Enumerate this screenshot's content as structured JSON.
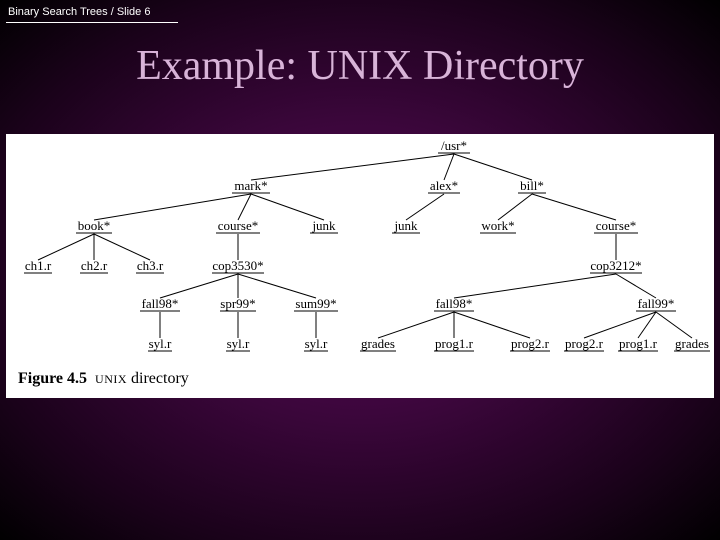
{
  "breadcrumb": "Binary Search Trees / Slide 6",
  "title": "Example: UNIX Directory",
  "caption": {
    "fignum": "Figure 4.5",
    "unix": "UNIX",
    "rest": "directory"
  },
  "tree": {
    "root": {
      "label": "/usr*"
    },
    "mark": {
      "label": "mark*"
    },
    "alex": {
      "label": "alex*"
    },
    "bill": {
      "label": "bill*"
    },
    "book": {
      "label": "book*"
    },
    "courseM": {
      "label": "course*"
    },
    "junkM": {
      "label": "junk"
    },
    "junkA": {
      "label": "junk"
    },
    "work": {
      "label": "work*"
    },
    "courseB": {
      "label": "course*"
    },
    "ch1": {
      "label": "ch1.r"
    },
    "ch2": {
      "label": "ch2.r"
    },
    "ch3": {
      "label": "ch3.r"
    },
    "cop3530": {
      "label": "cop3530*"
    },
    "cop3212": {
      "label": "cop3212*"
    },
    "fall98M": {
      "label": "fall98*"
    },
    "spr99": {
      "label": "spr99*"
    },
    "sum99": {
      "label": "sum99*"
    },
    "fall98B": {
      "label": "fall98*"
    },
    "fall99B": {
      "label": "fall99*"
    },
    "syl1": {
      "label": "syl.r"
    },
    "syl2": {
      "label": "syl.r"
    },
    "syl3": {
      "label": "syl.r"
    },
    "gradesB1": {
      "label": "grades"
    },
    "prog1B1": {
      "label": "prog1.r"
    },
    "prog2B1": {
      "label": "prog2.r"
    },
    "prog2B2": {
      "label": "prog2.r"
    },
    "prog1B2": {
      "label": "prog1.r"
    },
    "gradesB2": {
      "label": "grades"
    }
  }
}
